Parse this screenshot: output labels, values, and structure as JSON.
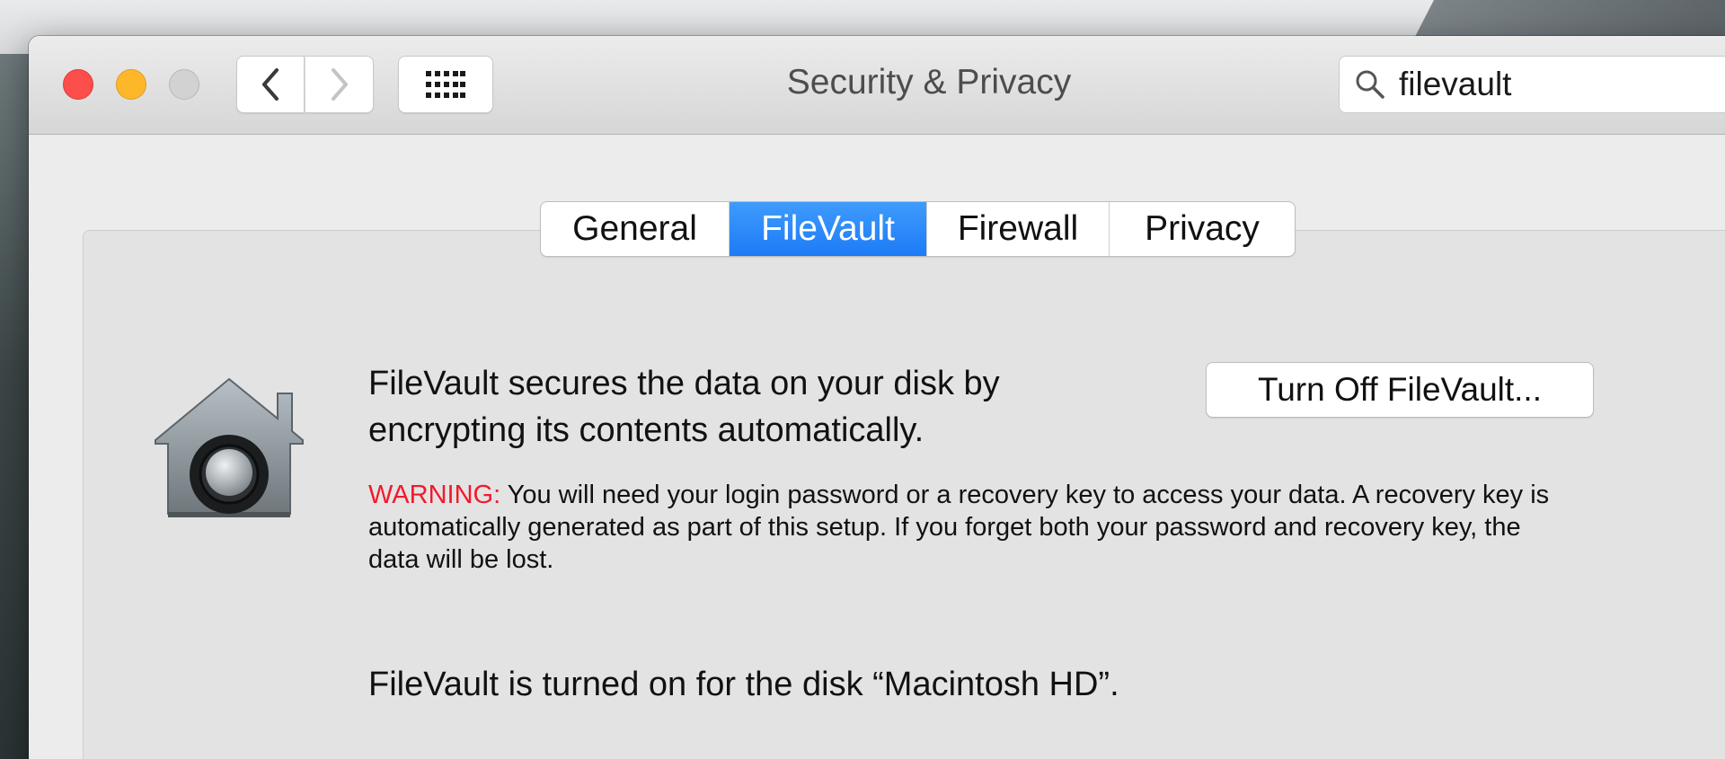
{
  "window": {
    "title": "Security & Privacy"
  },
  "search": {
    "value": "filevault",
    "icon": "search-icon"
  },
  "tabs": [
    {
      "label": "General",
      "active": false
    },
    {
      "label": "FileVault",
      "active": true
    },
    {
      "label": "Firewall",
      "active": false
    },
    {
      "label": "Privacy",
      "active": false
    }
  ],
  "filevault": {
    "description_line1": "FileVault secures the data on your disk by",
    "description_line2": "encrypting its contents automatically.",
    "turn_off_label": "Turn Off FileVault...",
    "warning_label": "WARNING:",
    "warning_text": " You will need your login password or a recovery key to access your data. A recovery key is automatically generated as part of this setup. If you forget both your password and recovery key, the data will be lost.",
    "status": "FileVault is turned on for the disk “Macintosh HD”."
  },
  "colors": {
    "accent": "#1d7bf6",
    "warning": "#f2192c",
    "close": "#fc4e4a",
    "minimize": "#fdb729"
  }
}
